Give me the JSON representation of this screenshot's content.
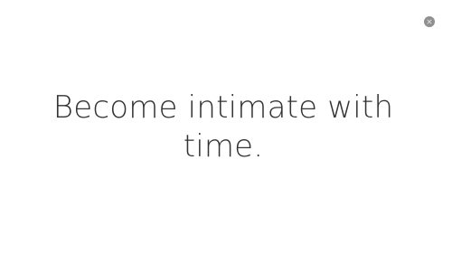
{
  "modal": {
    "headline": "Become intimate with time.",
    "close_icon": "close-icon"
  },
  "colors": {
    "background": "#ffffff",
    "text": "#333333",
    "close_button": "#8f8f8f"
  }
}
